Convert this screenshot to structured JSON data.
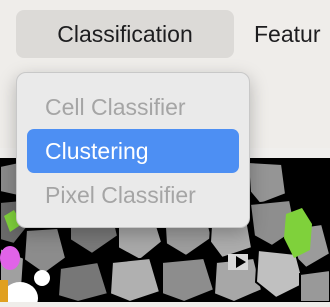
{
  "menubar": {
    "tabs": [
      {
        "label": "Classification"
      },
      {
        "label": "Featur"
      }
    ]
  },
  "dropdown": {
    "items": [
      {
        "label": "Cell Classifier",
        "enabled": false
      },
      {
        "label": "Clustering",
        "enabled": true,
        "selected": true
      },
      {
        "label": "Pixel Classifier",
        "enabled": false
      }
    ]
  },
  "colors": {
    "selection": "#4d8ff3",
    "disabled_text": "#a5a5a5"
  }
}
